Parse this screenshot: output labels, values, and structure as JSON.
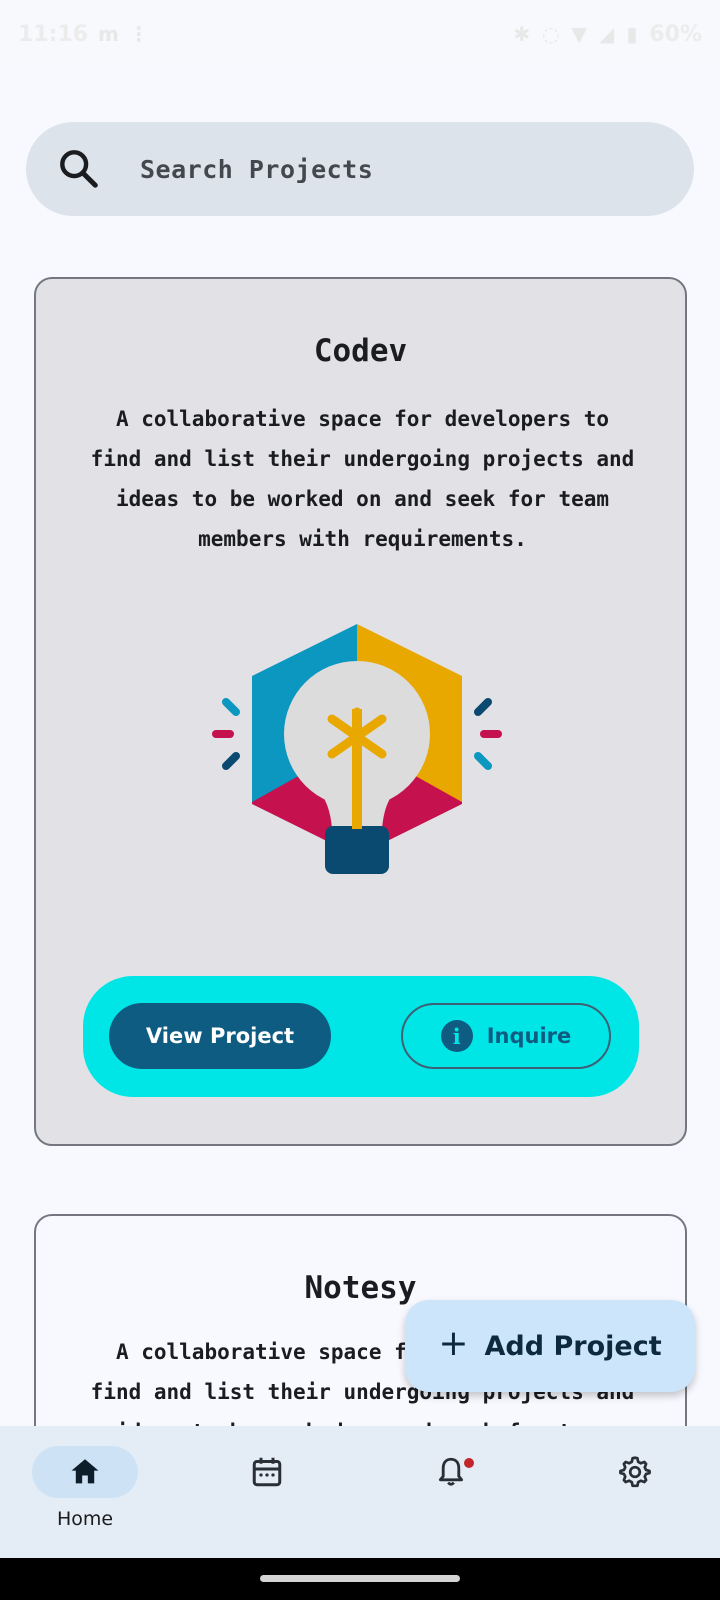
{
  "status_bar": {
    "time": "11:16",
    "battery": "60%"
  },
  "search": {
    "placeholder": "Search Projects"
  },
  "projects": [
    {
      "title": "Codev",
      "description": "A collaborative space for developers to find and list their undergoing projects and ideas to be worked on and seek for team members with requirements.",
      "view_label": "View Project",
      "inquire_label": "Inquire"
    },
    {
      "title": "Notesy",
      "description": "A collaborative space for developers to find and list their undergoing projects and ideas to be worked on and seek for team members with requirements."
    }
  ],
  "fab": {
    "label": "Add Project"
  },
  "bottom_nav": {
    "items": [
      {
        "label": "Home",
        "icon": "home-icon",
        "active": true
      },
      {
        "label": "",
        "icon": "calendar-icon",
        "active": false
      },
      {
        "label": "",
        "icon": "bell-icon",
        "active": false,
        "badge": true
      },
      {
        "label": "",
        "icon": "gear-icon",
        "active": false
      }
    ]
  },
  "colors": {
    "accent": "#0e5c82",
    "action_bar": "#00e6e6",
    "fab": "#cde5fb",
    "badge": "#c2262b"
  }
}
